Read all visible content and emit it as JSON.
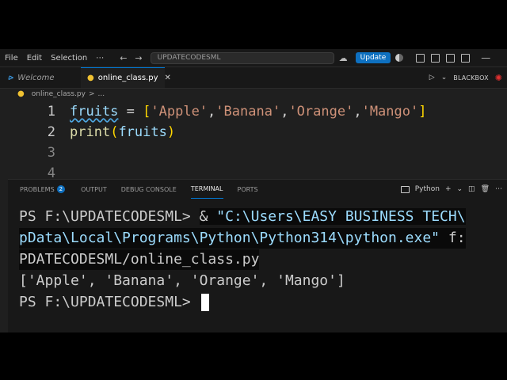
{
  "menu": [
    "File",
    "Edit",
    "Selection",
    "⋯"
  ],
  "command_center": "UPDATECODESML",
  "update_label": "Update",
  "tabs": [
    {
      "label": "Welcome"
    },
    {
      "label": "online_class.py"
    }
  ],
  "tab_bar_right": {
    "blackbox": "BLACKBOX"
  },
  "breadcrumb": {
    "file": "online_class.py",
    "sep": ">",
    "more": "..."
  },
  "editor": {
    "line_numbers": [
      "1",
      "2",
      "3",
      "4"
    ],
    "line1": {
      "var": "fruits",
      "eq": " = ",
      "open": "[",
      "s1": "'Apple'",
      "c1": ",",
      "s2": "'Banana'",
      "c2": ",",
      "s3": "'Orange'",
      "c3": ",",
      "s4": "'Mango'",
      "close": "]"
    },
    "line2": {
      "fn": "print",
      "open": "(",
      "arg": "fruits",
      "close": ")"
    }
  },
  "panel": {
    "tabs": [
      "PROBLEMS",
      "OUTPUT",
      "DEBUG CONSOLE",
      "TERMINAL",
      "PORTS"
    ],
    "problems_count": "2",
    "shell": "Python"
  },
  "terminal": {
    "prompt": "PS F:\\UPDATECODESML> ",
    "amp": "& ",
    "cmd_part1": "\"C:\\Users\\EASY BUSINESS TECH\\",
    "cmd_part2": "pData\\Local\\Programs\\Python\\Python314\\python.exe\"",
    "cmd_arg": " f:",
    "cmd_part3": "PDATECODESML/online_class.py",
    "output": "['Apple', 'Banana', 'Orange', 'Mango']",
    "prompt2": "PS F:\\UPDATECODESML> "
  },
  "colors": {
    "accent": "#0078d4",
    "update_button": "#0e70c0",
    "string": "#ce9178",
    "variable": "#9cdcfe",
    "function": "#dcdcaa"
  }
}
